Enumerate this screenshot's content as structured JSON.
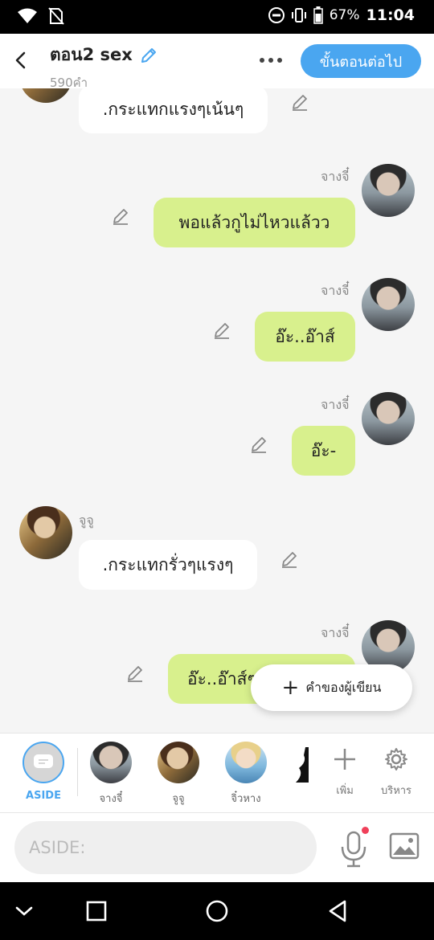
{
  "status_bar": {
    "battery": "67%",
    "time": "11:04",
    "icons": [
      "wifi-icon",
      "no-sim-icon",
      "dnd-icon",
      "vibrate-icon",
      "battery-icon"
    ]
  },
  "header": {
    "title": "ตอน2 sex",
    "word_count": "590คำ",
    "next_button": "ขั้นตอนต่อไป",
    "icons": [
      "back-icon",
      "pencil-icon",
      "more-icon"
    ]
  },
  "messages": [
    {
      "sender": "",
      "side": "left",
      "text": ".กระแทกแรงๆเน้นๆ"
    },
    {
      "sender": "จางจี๋",
      "side": "right",
      "text": "พอแล้วกูไม่ไหวแล้วว"
    },
    {
      "sender": "จางจี๋",
      "side": "right",
      "text": "อ๊ะ..อ๊าส์"
    },
    {
      "sender": "จางจี๋",
      "side": "right",
      "text": "อ๊ะ-"
    },
    {
      "sender": "จูจู",
      "side": "left",
      "text": ".กระแทกรั่วๆแรงๆ"
    },
    {
      "sender": "จางจี๋",
      "side": "right",
      "text": "อ๊ะ..อ๊าส์ๆ"
    }
  ],
  "fab": {
    "label": "คำของผู้เขียน",
    "icon": "plus-icon"
  },
  "characters": [
    {
      "name": "ASIDE",
      "avatar": "aside-icon"
    },
    {
      "name": "จางจี๋",
      "avatar": "avatar"
    },
    {
      "name": "จูจู",
      "avatar": "avatar"
    },
    {
      "name": "จิ๋วหาง",
      "avatar": "avatar"
    }
  ],
  "tools": {
    "add_label": "เพิ่ม",
    "manage_label": "บริหาร"
  },
  "input": {
    "placeholder": "ASIDE:"
  },
  "nav": [
    "chevron-down-icon",
    "square-icon",
    "circle-icon",
    "triangle-icon"
  ],
  "colors": {
    "accent": "#4aa6f0",
    "right_bubble": "#d8f08d",
    "left_bubble": "#ffffff",
    "background": "#f5f5f5"
  }
}
